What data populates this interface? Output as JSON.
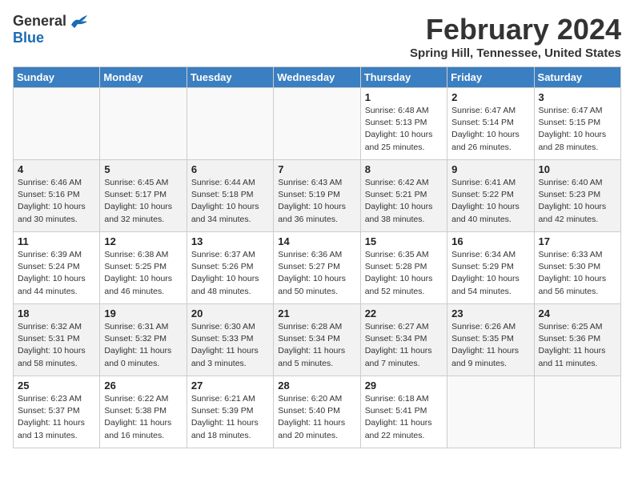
{
  "header": {
    "logo_general": "General",
    "logo_blue": "Blue",
    "month_title": "February 2024",
    "location": "Spring Hill, Tennessee, United States"
  },
  "weekdays": [
    "Sunday",
    "Monday",
    "Tuesday",
    "Wednesday",
    "Thursday",
    "Friday",
    "Saturday"
  ],
  "weeks": [
    [
      {
        "day": "",
        "info": ""
      },
      {
        "day": "",
        "info": ""
      },
      {
        "day": "",
        "info": ""
      },
      {
        "day": "",
        "info": ""
      },
      {
        "day": "1",
        "info": "Sunrise: 6:48 AM\nSunset: 5:13 PM\nDaylight: 10 hours\nand 25 minutes."
      },
      {
        "day": "2",
        "info": "Sunrise: 6:47 AM\nSunset: 5:14 PM\nDaylight: 10 hours\nand 26 minutes."
      },
      {
        "day": "3",
        "info": "Sunrise: 6:47 AM\nSunset: 5:15 PM\nDaylight: 10 hours\nand 28 minutes."
      }
    ],
    [
      {
        "day": "4",
        "info": "Sunrise: 6:46 AM\nSunset: 5:16 PM\nDaylight: 10 hours\nand 30 minutes."
      },
      {
        "day": "5",
        "info": "Sunrise: 6:45 AM\nSunset: 5:17 PM\nDaylight: 10 hours\nand 32 minutes."
      },
      {
        "day": "6",
        "info": "Sunrise: 6:44 AM\nSunset: 5:18 PM\nDaylight: 10 hours\nand 34 minutes."
      },
      {
        "day": "7",
        "info": "Sunrise: 6:43 AM\nSunset: 5:19 PM\nDaylight: 10 hours\nand 36 minutes."
      },
      {
        "day": "8",
        "info": "Sunrise: 6:42 AM\nSunset: 5:21 PM\nDaylight: 10 hours\nand 38 minutes."
      },
      {
        "day": "9",
        "info": "Sunrise: 6:41 AM\nSunset: 5:22 PM\nDaylight: 10 hours\nand 40 minutes."
      },
      {
        "day": "10",
        "info": "Sunrise: 6:40 AM\nSunset: 5:23 PM\nDaylight: 10 hours\nand 42 minutes."
      }
    ],
    [
      {
        "day": "11",
        "info": "Sunrise: 6:39 AM\nSunset: 5:24 PM\nDaylight: 10 hours\nand 44 minutes."
      },
      {
        "day": "12",
        "info": "Sunrise: 6:38 AM\nSunset: 5:25 PM\nDaylight: 10 hours\nand 46 minutes."
      },
      {
        "day": "13",
        "info": "Sunrise: 6:37 AM\nSunset: 5:26 PM\nDaylight: 10 hours\nand 48 minutes."
      },
      {
        "day": "14",
        "info": "Sunrise: 6:36 AM\nSunset: 5:27 PM\nDaylight: 10 hours\nand 50 minutes."
      },
      {
        "day": "15",
        "info": "Sunrise: 6:35 AM\nSunset: 5:28 PM\nDaylight: 10 hours\nand 52 minutes."
      },
      {
        "day": "16",
        "info": "Sunrise: 6:34 AM\nSunset: 5:29 PM\nDaylight: 10 hours\nand 54 minutes."
      },
      {
        "day": "17",
        "info": "Sunrise: 6:33 AM\nSunset: 5:30 PM\nDaylight: 10 hours\nand 56 minutes."
      }
    ],
    [
      {
        "day": "18",
        "info": "Sunrise: 6:32 AM\nSunset: 5:31 PM\nDaylight: 10 hours\nand 58 minutes."
      },
      {
        "day": "19",
        "info": "Sunrise: 6:31 AM\nSunset: 5:32 PM\nDaylight: 11 hours\nand 0 minutes."
      },
      {
        "day": "20",
        "info": "Sunrise: 6:30 AM\nSunset: 5:33 PM\nDaylight: 11 hours\nand 3 minutes."
      },
      {
        "day": "21",
        "info": "Sunrise: 6:28 AM\nSunset: 5:34 PM\nDaylight: 11 hours\nand 5 minutes."
      },
      {
        "day": "22",
        "info": "Sunrise: 6:27 AM\nSunset: 5:34 PM\nDaylight: 11 hours\nand 7 minutes."
      },
      {
        "day": "23",
        "info": "Sunrise: 6:26 AM\nSunset: 5:35 PM\nDaylight: 11 hours\nand 9 minutes."
      },
      {
        "day": "24",
        "info": "Sunrise: 6:25 AM\nSunset: 5:36 PM\nDaylight: 11 hours\nand 11 minutes."
      }
    ],
    [
      {
        "day": "25",
        "info": "Sunrise: 6:23 AM\nSunset: 5:37 PM\nDaylight: 11 hours\nand 13 minutes."
      },
      {
        "day": "26",
        "info": "Sunrise: 6:22 AM\nSunset: 5:38 PM\nDaylight: 11 hours\nand 16 minutes."
      },
      {
        "day": "27",
        "info": "Sunrise: 6:21 AM\nSunset: 5:39 PM\nDaylight: 11 hours\nand 18 minutes."
      },
      {
        "day": "28",
        "info": "Sunrise: 6:20 AM\nSunset: 5:40 PM\nDaylight: 11 hours\nand 20 minutes."
      },
      {
        "day": "29",
        "info": "Sunrise: 6:18 AM\nSunset: 5:41 PM\nDaylight: 11 hours\nand 22 minutes."
      },
      {
        "day": "",
        "info": ""
      },
      {
        "day": "",
        "info": ""
      }
    ]
  ]
}
